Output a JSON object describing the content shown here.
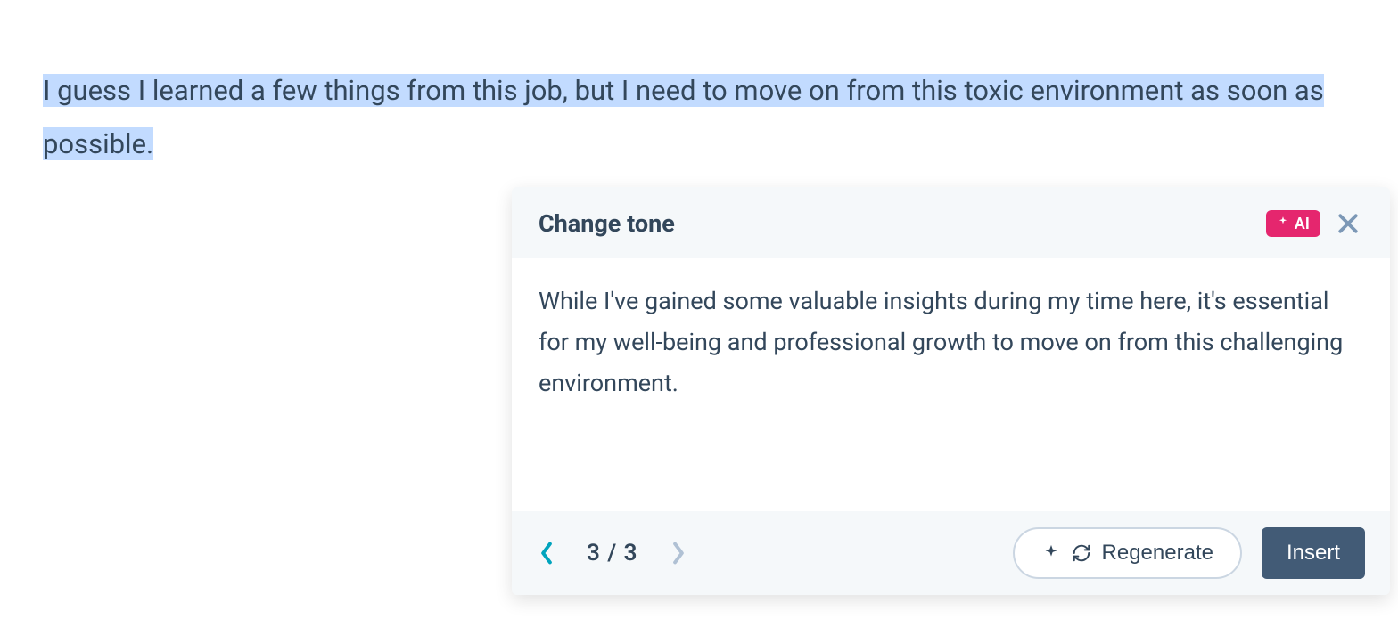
{
  "editor": {
    "selected_text": "I guess I learned a few things from this job, but I need to move on from this toxic environment as soon as possible."
  },
  "popup": {
    "title": "Change tone",
    "ai_badge": "AI",
    "suggestion": "While I've gained some valuable insights during my time here, it's essential for my well-being and professional growth to move on from this challenging environment.",
    "pager": "3 / 3",
    "regenerate_label": "Regenerate",
    "insert_label": "Insert"
  }
}
